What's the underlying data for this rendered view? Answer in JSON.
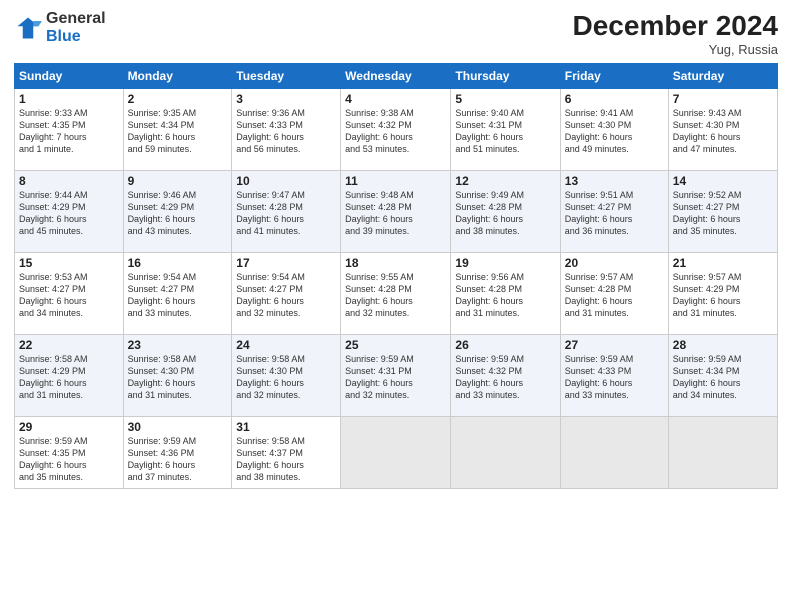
{
  "header": {
    "logo": {
      "general": "General",
      "blue": "Blue"
    },
    "title": "December 2024",
    "location": "Yug, Russia"
  },
  "days_of_week": [
    "Sunday",
    "Monday",
    "Tuesday",
    "Wednesday",
    "Thursday",
    "Friday",
    "Saturday"
  ],
  "weeks": [
    [
      {
        "day": 1,
        "info": "Sunrise: 9:33 AM\nSunset: 4:35 PM\nDaylight: 7 hours\nand 1 minute."
      },
      {
        "day": 2,
        "info": "Sunrise: 9:35 AM\nSunset: 4:34 PM\nDaylight: 6 hours\nand 59 minutes."
      },
      {
        "day": 3,
        "info": "Sunrise: 9:36 AM\nSunset: 4:33 PM\nDaylight: 6 hours\nand 56 minutes."
      },
      {
        "day": 4,
        "info": "Sunrise: 9:38 AM\nSunset: 4:32 PM\nDaylight: 6 hours\nand 53 minutes."
      },
      {
        "day": 5,
        "info": "Sunrise: 9:40 AM\nSunset: 4:31 PM\nDaylight: 6 hours\nand 51 minutes."
      },
      {
        "day": 6,
        "info": "Sunrise: 9:41 AM\nSunset: 4:30 PM\nDaylight: 6 hours\nand 49 minutes."
      },
      {
        "day": 7,
        "info": "Sunrise: 9:43 AM\nSunset: 4:30 PM\nDaylight: 6 hours\nand 47 minutes."
      }
    ],
    [
      {
        "day": 8,
        "info": "Sunrise: 9:44 AM\nSunset: 4:29 PM\nDaylight: 6 hours\nand 45 minutes."
      },
      {
        "day": 9,
        "info": "Sunrise: 9:46 AM\nSunset: 4:29 PM\nDaylight: 6 hours\nand 43 minutes."
      },
      {
        "day": 10,
        "info": "Sunrise: 9:47 AM\nSunset: 4:28 PM\nDaylight: 6 hours\nand 41 minutes."
      },
      {
        "day": 11,
        "info": "Sunrise: 9:48 AM\nSunset: 4:28 PM\nDaylight: 6 hours\nand 39 minutes."
      },
      {
        "day": 12,
        "info": "Sunrise: 9:49 AM\nSunset: 4:28 PM\nDaylight: 6 hours\nand 38 minutes."
      },
      {
        "day": 13,
        "info": "Sunrise: 9:51 AM\nSunset: 4:27 PM\nDaylight: 6 hours\nand 36 minutes."
      },
      {
        "day": 14,
        "info": "Sunrise: 9:52 AM\nSunset: 4:27 PM\nDaylight: 6 hours\nand 35 minutes."
      }
    ],
    [
      {
        "day": 15,
        "info": "Sunrise: 9:53 AM\nSunset: 4:27 PM\nDaylight: 6 hours\nand 34 minutes."
      },
      {
        "day": 16,
        "info": "Sunrise: 9:54 AM\nSunset: 4:27 PM\nDaylight: 6 hours\nand 33 minutes."
      },
      {
        "day": 17,
        "info": "Sunrise: 9:54 AM\nSunset: 4:27 PM\nDaylight: 6 hours\nand 32 minutes."
      },
      {
        "day": 18,
        "info": "Sunrise: 9:55 AM\nSunset: 4:28 PM\nDaylight: 6 hours\nand 32 minutes."
      },
      {
        "day": 19,
        "info": "Sunrise: 9:56 AM\nSunset: 4:28 PM\nDaylight: 6 hours\nand 31 minutes."
      },
      {
        "day": 20,
        "info": "Sunrise: 9:57 AM\nSunset: 4:28 PM\nDaylight: 6 hours\nand 31 minutes."
      },
      {
        "day": 21,
        "info": "Sunrise: 9:57 AM\nSunset: 4:29 PM\nDaylight: 6 hours\nand 31 minutes."
      }
    ],
    [
      {
        "day": 22,
        "info": "Sunrise: 9:58 AM\nSunset: 4:29 PM\nDaylight: 6 hours\nand 31 minutes."
      },
      {
        "day": 23,
        "info": "Sunrise: 9:58 AM\nSunset: 4:30 PM\nDaylight: 6 hours\nand 31 minutes."
      },
      {
        "day": 24,
        "info": "Sunrise: 9:58 AM\nSunset: 4:30 PM\nDaylight: 6 hours\nand 32 minutes."
      },
      {
        "day": 25,
        "info": "Sunrise: 9:59 AM\nSunset: 4:31 PM\nDaylight: 6 hours\nand 32 minutes."
      },
      {
        "day": 26,
        "info": "Sunrise: 9:59 AM\nSunset: 4:32 PM\nDaylight: 6 hours\nand 33 minutes."
      },
      {
        "day": 27,
        "info": "Sunrise: 9:59 AM\nSunset: 4:33 PM\nDaylight: 6 hours\nand 33 minutes."
      },
      {
        "day": 28,
        "info": "Sunrise: 9:59 AM\nSunset: 4:34 PM\nDaylight: 6 hours\nand 34 minutes."
      }
    ],
    [
      {
        "day": 29,
        "info": "Sunrise: 9:59 AM\nSunset: 4:35 PM\nDaylight: 6 hours\nand 35 minutes."
      },
      {
        "day": 30,
        "info": "Sunrise: 9:59 AM\nSunset: 4:36 PM\nDaylight: 6 hours\nand 37 minutes."
      },
      {
        "day": 31,
        "info": "Sunrise: 9:58 AM\nSunset: 4:37 PM\nDaylight: 6 hours\nand 38 minutes."
      },
      null,
      null,
      null,
      null
    ]
  ]
}
